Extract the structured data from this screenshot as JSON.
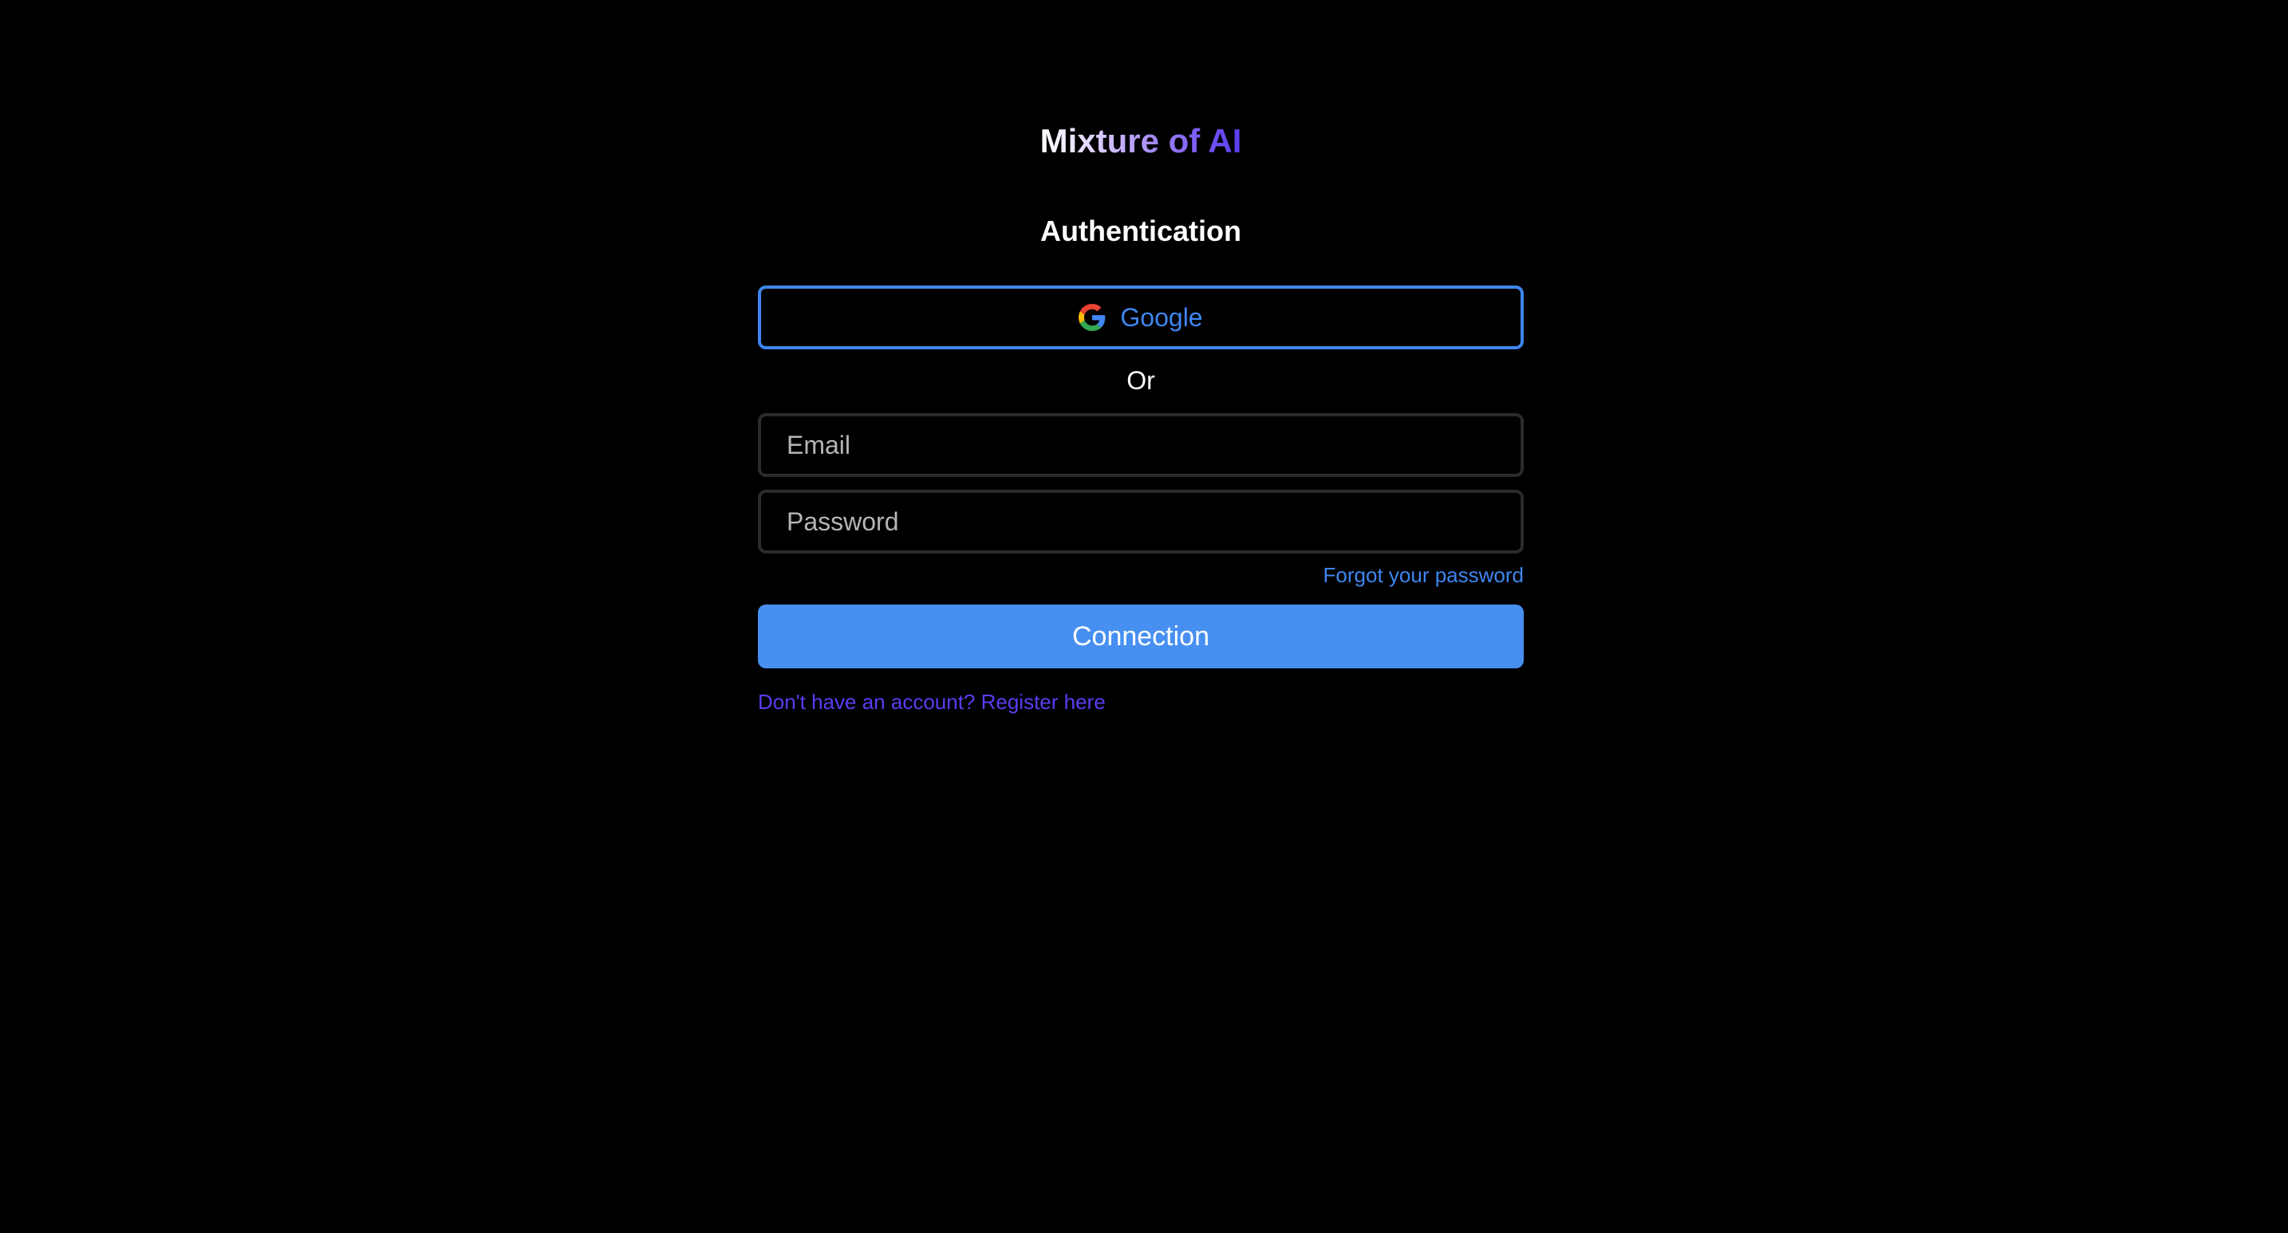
{
  "brand": {
    "name": "Mixture of AI"
  },
  "auth": {
    "heading": "Authentication",
    "google_label": "Google",
    "google_icon": "google-icon",
    "separator": "Or",
    "email_placeholder": "Email",
    "password_placeholder": "Password",
    "email_value": "",
    "password_value": "",
    "forgot_label": "Forgot your password",
    "submit_label": "Connection",
    "register_label": "Don't have an account? Register here"
  },
  "colors": {
    "background": "#000000",
    "accent_blue": "#3f86f0",
    "button_blue": "#4790f2",
    "brand_purple": "#5b3cf0",
    "input_border": "#2b2b2b"
  }
}
